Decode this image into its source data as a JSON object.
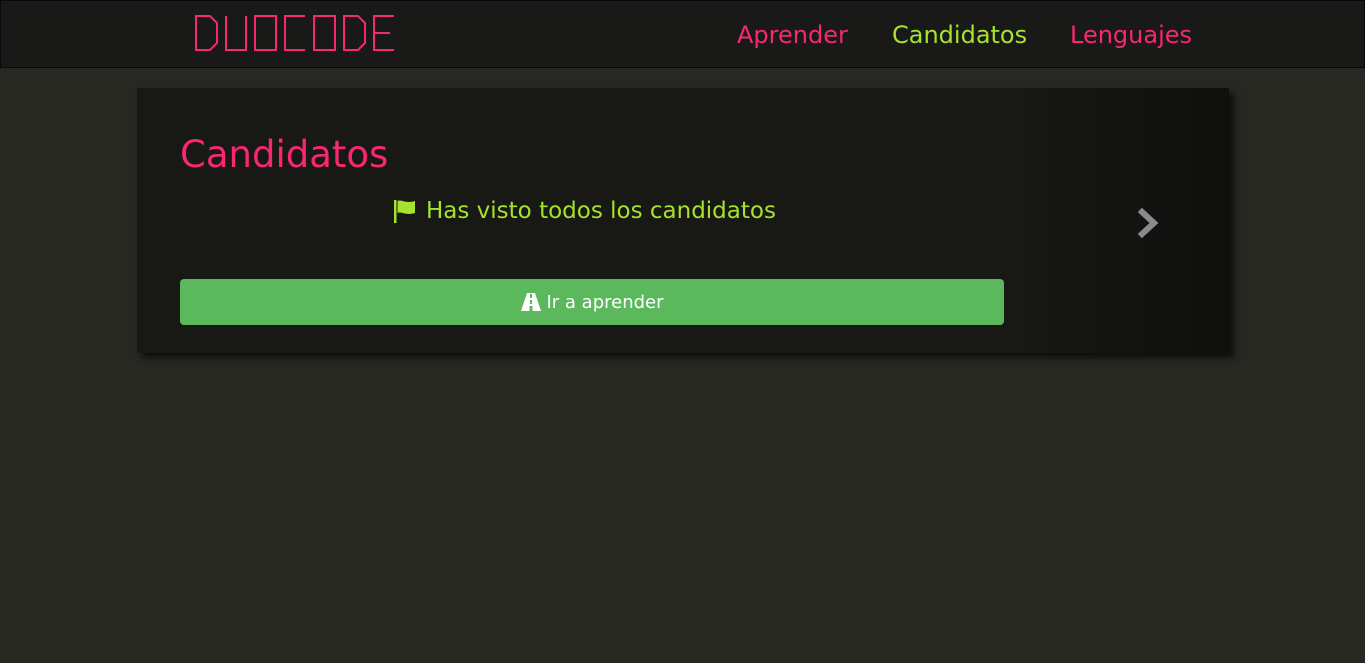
{
  "brand": {
    "logo_text": "DUOCODE",
    "logo_color": "#f92672"
  },
  "nav": {
    "items": [
      {
        "label": "Aprender",
        "active": false
      },
      {
        "label": "Candidatos",
        "active": true
      },
      {
        "label": "Lenguajes",
        "active": false
      }
    ]
  },
  "card": {
    "title": "Candidatos",
    "status_icon": "flag-icon",
    "status_text": "Has visto todos los candidatos",
    "next_icon": "chevron-right-icon",
    "button_icon": "road-icon",
    "button_label": "Ir a aprender"
  },
  "colors": {
    "pink": "#f92672",
    "green": "#a6e22e",
    "button_green": "#5cb85c",
    "background": "#272822",
    "panel": "#181815"
  }
}
